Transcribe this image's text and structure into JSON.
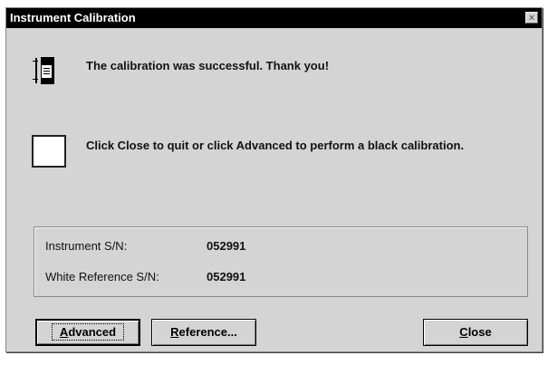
{
  "window": {
    "title": "Instrument Calibration",
    "close_glyph": "×"
  },
  "messages": {
    "success": "The calibration was successful.  Thank you!",
    "instruction": "Click Close to quit or click Advanced to perform a black calibration."
  },
  "info": {
    "instrument_sn_label": "Instrument S/N:",
    "instrument_sn_value": "052991",
    "white_reference_sn_label": "White Reference S/N:",
    "white_reference_sn_value": "052991"
  },
  "buttons": {
    "advanced": {
      "mnemonic": "A",
      "rest": "dvanced"
    },
    "reference": {
      "mnemonic": "R",
      "rest": "eference..."
    },
    "close": {
      "mnemonic": "C",
      "rest": "lose"
    }
  }
}
